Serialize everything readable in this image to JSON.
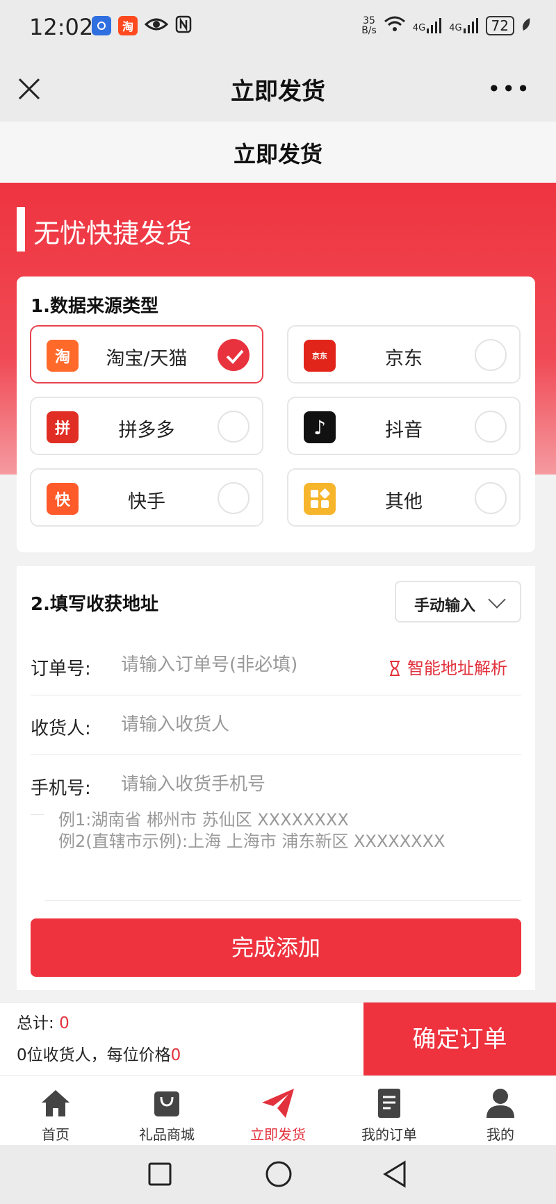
{
  "status_bar": {
    "time": "12:02",
    "net_speed_value": "35",
    "net_speed_unit": "B/s",
    "signal_1": "4G",
    "signal_2": "4G",
    "battery": "72",
    "icons": [
      "blue-app-icon",
      "taobao-icon",
      "eye-icon",
      "nfc-icon",
      "wifi-icon",
      "signal-icon",
      "battery-icon",
      "leaf-icon"
    ]
  },
  "title_bar": {
    "title": "立即发货",
    "more": "•••"
  },
  "subheader": {
    "title": "立即发货"
  },
  "hero": {
    "title": "无忧快捷发货"
  },
  "source_section": {
    "title": "1.数据来源类型",
    "options": [
      {
        "label": "淘宝/天猫",
        "icon": "taobao-icon",
        "glyph": "淘",
        "color": "#ff6a2b",
        "selected": true
      },
      {
        "label": "京东",
        "icon": "jd-icon",
        "glyph": "京东",
        "color": "#e1251b",
        "selected": false
      },
      {
        "label": "拼多多",
        "icon": "pinduoduo-icon",
        "glyph": "拼",
        "color": "#e02e24",
        "selected": false
      },
      {
        "label": "抖音",
        "icon": "douyin-icon",
        "glyph": "♪",
        "color": "#111111",
        "selected": false
      },
      {
        "label": "快手",
        "icon": "kuaishou-icon",
        "glyph": "快",
        "color": "#ff5a2a",
        "selected": false
      },
      {
        "label": "其他",
        "icon": "apps-icon",
        "glyph": "",
        "color": "#f7b52c",
        "selected": false
      }
    ]
  },
  "address_section": {
    "title": "2.填写收获地址",
    "mode": "手动输入",
    "order_no": {
      "label": "订单号:",
      "placeholder": "请输入订单号(非必填)"
    },
    "smart_parse": "智能地址解析",
    "receiver": {
      "label": "收货人:",
      "placeholder": "请输入收货人"
    },
    "phone": {
      "label": "手机号:",
      "placeholder": "请输入收货手机号"
    },
    "address_placeholder": "例1:湖南省 郴州市 苏仙区 XXXXXXXX\n例2(直辖市示例):上海 上海市 浦东新区 XXXXXXXX",
    "done_button": "完成添加"
  },
  "summary": {
    "total_label": "总计:",
    "total_value": "0",
    "count_label": "0位收货人，每位价格",
    "price_value": "0",
    "confirm_button": "确定订单"
  },
  "tabs": [
    {
      "label": "首页",
      "icon": "home-icon",
      "active": false
    },
    {
      "label": "礼品商城",
      "icon": "shopping-bag-icon",
      "active": false
    },
    {
      "label": "立即发货",
      "icon": "paper-plane-icon",
      "active": true
    },
    {
      "label": "我的订单",
      "icon": "order-document-icon",
      "active": false
    },
    {
      "label": "我的",
      "icon": "user-icon",
      "active": false
    }
  ],
  "colors": {
    "accent": "#ee323e",
    "accent_text": "#e2323d"
  }
}
